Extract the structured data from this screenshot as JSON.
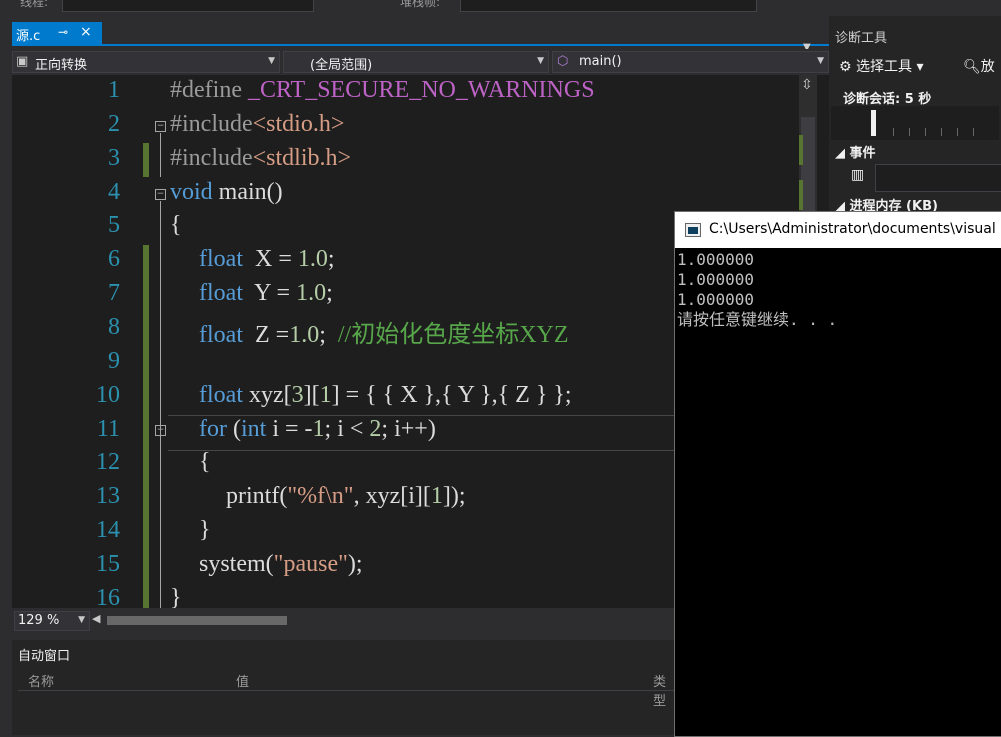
{
  "topbar": {
    "label_left": "线程:",
    "label_right": "堆栈帧:"
  },
  "tab": {
    "name": "源.c",
    "pin": "⊸",
    "close": "×"
  },
  "navbar": {
    "project": "正向转换",
    "scope": "(全局范围)",
    "function": "main()"
  },
  "editor": {
    "lines": [
      {
        "n": "1"
      },
      {
        "n": "2"
      },
      {
        "n": "3"
      },
      {
        "n": "4"
      },
      {
        "n": "5"
      },
      {
        "n": "6"
      },
      {
        "n": "7"
      },
      {
        "n": "8"
      },
      {
        "n": "9"
      },
      {
        "n": "10"
      },
      {
        "n": "11"
      },
      {
        "n": "12"
      },
      {
        "n": "13"
      },
      {
        "n": "14"
      },
      {
        "n": "15"
      },
      {
        "n": "16"
      }
    ],
    "code": {
      "l1_a": "#define ",
      "l1_b": "_CRT_SECURE_NO_WARNINGS",
      "l2_a": "#include",
      "l2_b": "<stdio.h>",
      "l3_a": "#include",
      "l3_b": "<stdlib.h>",
      "l4_a": "void",
      "l4_b": " main()",
      "l5": "{",
      "l6_a": "float",
      "l6_b": "  X = ",
      "l6_c": "1.0",
      "l6_d": ";",
      "l7_a": "float",
      "l7_b": "  Y = ",
      "l7_c": "1.0",
      "l7_d": ";",
      "l8_a": "float",
      "l8_b": "  Z =",
      "l8_c": "1.0",
      "l8_d": ";  ",
      "l8_e": "//初始化色度坐标XYZ",
      "l10_a": "float",
      "l10_b": " xyz[",
      "l10_c": "3",
      "l10_d": "][",
      "l10_e": "1",
      "l10_f": "] = { { X },{ Y },{ Z } };",
      "l11_a": "for",
      "l11_b": " (",
      "l11_c": "int",
      "l11_d": " i = -",
      "l11_e": "1",
      "l11_f": "; i < ",
      "l11_g": "2",
      "l11_h": "; i++)",
      "l12": "{",
      "l13_a": "printf(",
      "l13_b": "\"%f\\n\"",
      "l13_c": ", xyz[i][",
      "l13_d": "1",
      "l13_e": "]);",
      "l14": "}",
      "l15_a": "system(",
      "l15_b": "\"pause\"",
      "l15_c": ");",
      "l16": "}"
    },
    "zoom": "129 %"
  },
  "autos": {
    "title": "自动窗口",
    "columns": [
      "名称",
      "值",
      "类型"
    ]
  },
  "diagnostics": {
    "title": "诊断工具",
    "select_tool": "选择工具",
    "zoom_label": "放",
    "session": "诊断会话: 5 秒",
    "events": "事件",
    "process_memory": "进程内存 (KB)"
  },
  "console": {
    "title": "C:\\Users\\Administrator\\documents\\visual",
    "output": [
      "1.000000",
      "1.000000",
      "1.000000",
      "请按任意键继续. . ."
    ]
  },
  "colors": {
    "accent": "#007acc",
    "keyword": "#569cd6",
    "macro": "#bd63c5",
    "string": "#d69d85",
    "comment": "#57a64a",
    "line_number": "#2b91af"
  }
}
